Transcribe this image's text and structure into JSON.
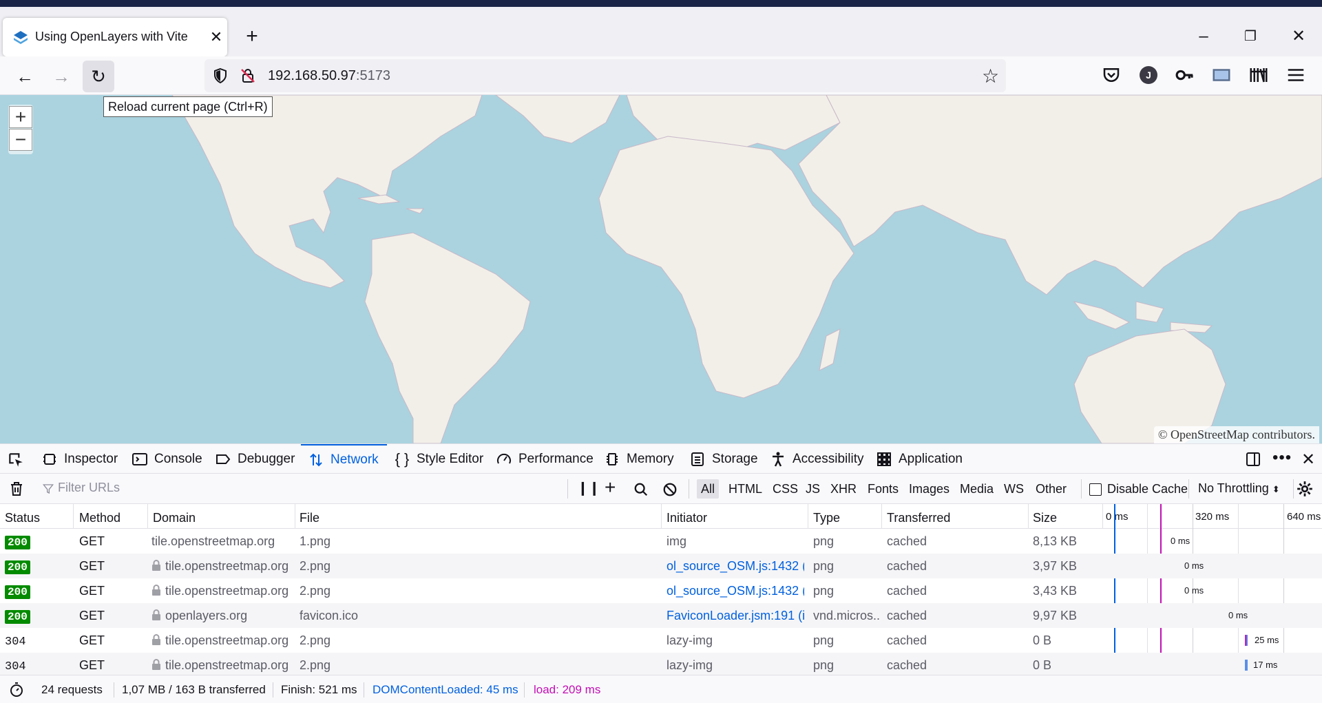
{
  "browser": {
    "tab_title": "Using OpenLayers with Vite",
    "url_host": "192.168.50.97",
    "url_port": ":5173",
    "tooltip": "Reload current page (Ctrl+R)",
    "profile_initial": "J"
  },
  "map": {
    "zoom_in": "+",
    "zoom_out": "−",
    "attribution": "© OpenStreetMap contributors."
  },
  "devtools": {
    "tabs": [
      {
        "label": "Inspector"
      },
      {
        "label": "Console"
      },
      {
        "label": "Debugger"
      },
      {
        "label": "Network"
      },
      {
        "label": "Style Editor"
      },
      {
        "label": "Performance"
      },
      {
        "label": "Memory"
      },
      {
        "label": "Storage"
      },
      {
        "label": "Accessibility"
      },
      {
        "label": "Application"
      }
    ],
    "active_tab": "Network",
    "filter_placeholder": "Filter URLs",
    "type_filters": [
      "All",
      "HTML",
      "CSS",
      "JS",
      "XHR",
      "Fonts",
      "Images",
      "Media",
      "WS",
      "Other"
    ],
    "disable_cache": "Disable Cache",
    "throttling": "No Throttling"
  },
  "network": {
    "columns": [
      "Status",
      "Method",
      "Domain",
      "File",
      "Initiator",
      "Type",
      "Transferred",
      "Size"
    ],
    "timeline_ticks": [
      "0 ms",
      "320 ms",
      "640 ms"
    ],
    "rows": [
      {
        "status": "200",
        "method": "GET",
        "domain": "tile.openstreetmap.org",
        "file": "1.png",
        "initiator": "img",
        "type": "png",
        "transferred": "cached",
        "size": "8,13 KB",
        "timing": "0 ms"
      },
      {
        "status": "200",
        "method": "GET",
        "domain": "tile.openstreetmap.org",
        "file": "2.png",
        "initiator": "ol_source_OSM.js:1432 (i...",
        "type": "png",
        "transferred": "cached",
        "size": "3,97 KB",
        "timing": "0 ms"
      },
      {
        "status": "200",
        "method": "GET",
        "domain": "tile.openstreetmap.org",
        "file": "2.png",
        "initiator": "ol_source_OSM.js:1432 (i...",
        "type": "png",
        "transferred": "cached",
        "size": "3,43 KB",
        "timing": "0 ms"
      },
      {
        "status": "200",
        "method": "GET",
        "domain": "openlayers.org",
        "file": "favicon.ico",
        "initiator": "FaviconLoader.jsm:191 (i...",
        "type": "vnd.micros...",
        "transferred": "cached",
        "size": "9,97 KB",
        "timing": "0 ms"
      },
      {
        "status": "304",
        "method": "GET",
        "domain": "tile.openstreetmap.org",
        "file": "2.png",
        "initiator": "lazy-img",
        "type": "png",
        "transferred": "cached",
        "size": "0 B",
        "timing": "25 ms"
      },
      {
        "status": "304",
        "method": "GET",
        "domain": "tile.openstreetmap.org",
        "file": "2.png",
        "initiator": "lazy-img",
        "type": "png",
        "transferred": "cached",
        "size": "0 B",
        "timing": "17 ms"
      }
    ],
    "summary": {
      "requests": "24 requests",
      "transferred": "1,07 MB / 163 B transferred",
      "finish": "Finish: 521 ms",
      "domcontentloaded": "DOMContentLoaded: 45 ms",
      "load": "load: 209 ms"
    }
  },
  "colors": {
    "accent": "#0060df",
    "status_ok": "#058b00",
    "load_marker": "#c20fb4",
    "ocean": "#aad3df",
    "land": "#f2efe9"
  }
}
